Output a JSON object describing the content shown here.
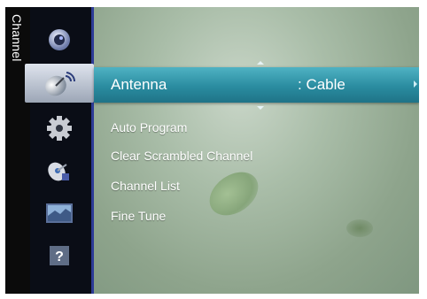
{
  "sidebar": {
    "section_label": "Channel",
    "icons": [
      {
        "name": "picture-icon"
      },
      {
        "name": "channel-antenna-icon",
        "active": true
      },
      {
        "name": "setup-gear-icon"
      },
      {
        "name": "input-satellite-icon"
      },
      {
        "name": "application-image-icon"
      },
      {
        "name": "support-help-icon"
      }
    ]
  },
  "menu": {
    "selected": {
      "label": "Antenna",
      "value": ": Cable"
    },
    "items": [
      {
        "label": "Auto Program"
      },
      {
        "label": "Clear Scrambled Channel"
      },
      {
        "label": "Channel List"
      },
      {
        "label": "Fine Tune"
      }
    ]
  },
  "colors": {
    "highlight": "#2a8ca0",
    "sidebar_edge": "#2d3b96"
  }
}
